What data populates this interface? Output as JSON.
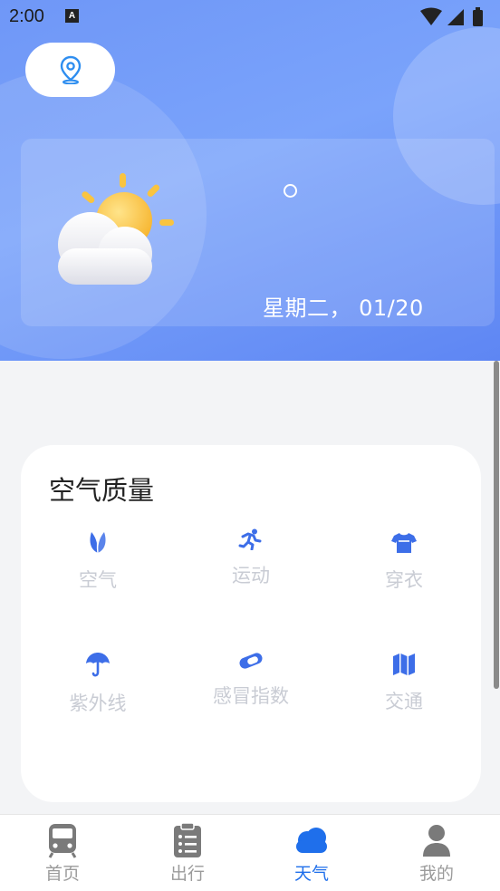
{
  "status_bar": {
    "time": "2:00",
    "notification_icon_text": "A"
  },
  "header": {
    "location_button_icon": "location-pin-icon",
    "weather_icon": "partly-cloudy-icon",
    "temperature_unit_icon": "degree-circle",
    "date": "星期二， 01/20"
  },
  "air_quality": {
    "title": "空气质量",
    "items": [
      {
        "label": "空气",
        "icon": "leaf-icon"
      },
      {
        "label": "运动",
        "icon": "running-icon"
      },
      {
        "label": "穿衣",
        "icon": "shirt-icon"
      },
      {
        "label": "紫外线",
        "icon": "umbrella-icon"
      },
      {
        "label": "感冒指数",
        "icon": "pill-icon"
      },
      {
        "label": "交通",
        "icon": "map-icon"
      }
    ]
  },
  "nav": {
    "items": [
      {
        "label": "首页",
        "icon": "train-icon"
      },
      {
        "label": "出行",
        "icon": "clipboard-list-icon"
      },
      {
        "label": "天气",
        "icon": "cloud-icon",
        "active": true
      },
      {
        "label": "我的",
        "icon": "user-icon"
      }
    ]
  },
  "colors": {
    "accent": "#1f6feb",
    "icon_blue": "#3d6ee8",
    "label_gray": "#c9ccd4",
    "hero_blue": "#6f97f7"
  }
}
